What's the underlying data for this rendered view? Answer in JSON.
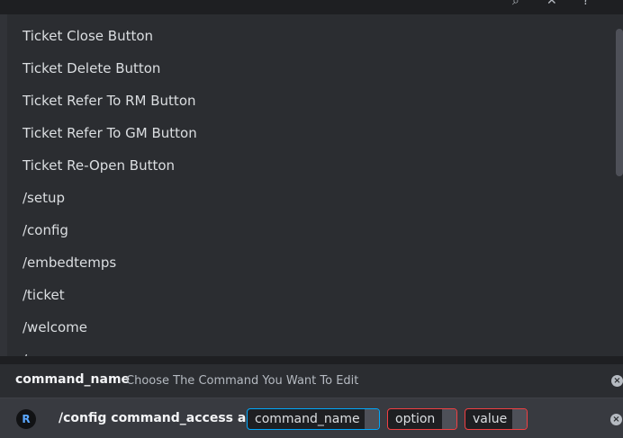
{
  "menu_items": [
    "Ticket Close Button",
    "Ticket Delete Button",
    "Ticket Refer To RM Button",
    "Ticket Refer To GM Button",
    "Ticket Re-Open Button",
    "/setup",
    "/config",
    "/embedtemps",
    "/ticket",
    "/welcome",
    "/..."
  ],
  "hint": {
    "option_name": "command_name",
    "description": "Choose The Command You Want To Edit"
  },
  "command": {
    "bot_initial": "R",
    "text": "/config command_access add",
    "options": [
      {
        "label": "command_name"
      },
      {
        "label": "option"
      },
      {
        "label": "value"
      }
    ]
  },
  "icons": {
    "close": "×"
  },
  "colors": {
    "active_border": "#00a8fc",
    "error_border": "#f23f42",
    "background": "#313338"
  }
}
